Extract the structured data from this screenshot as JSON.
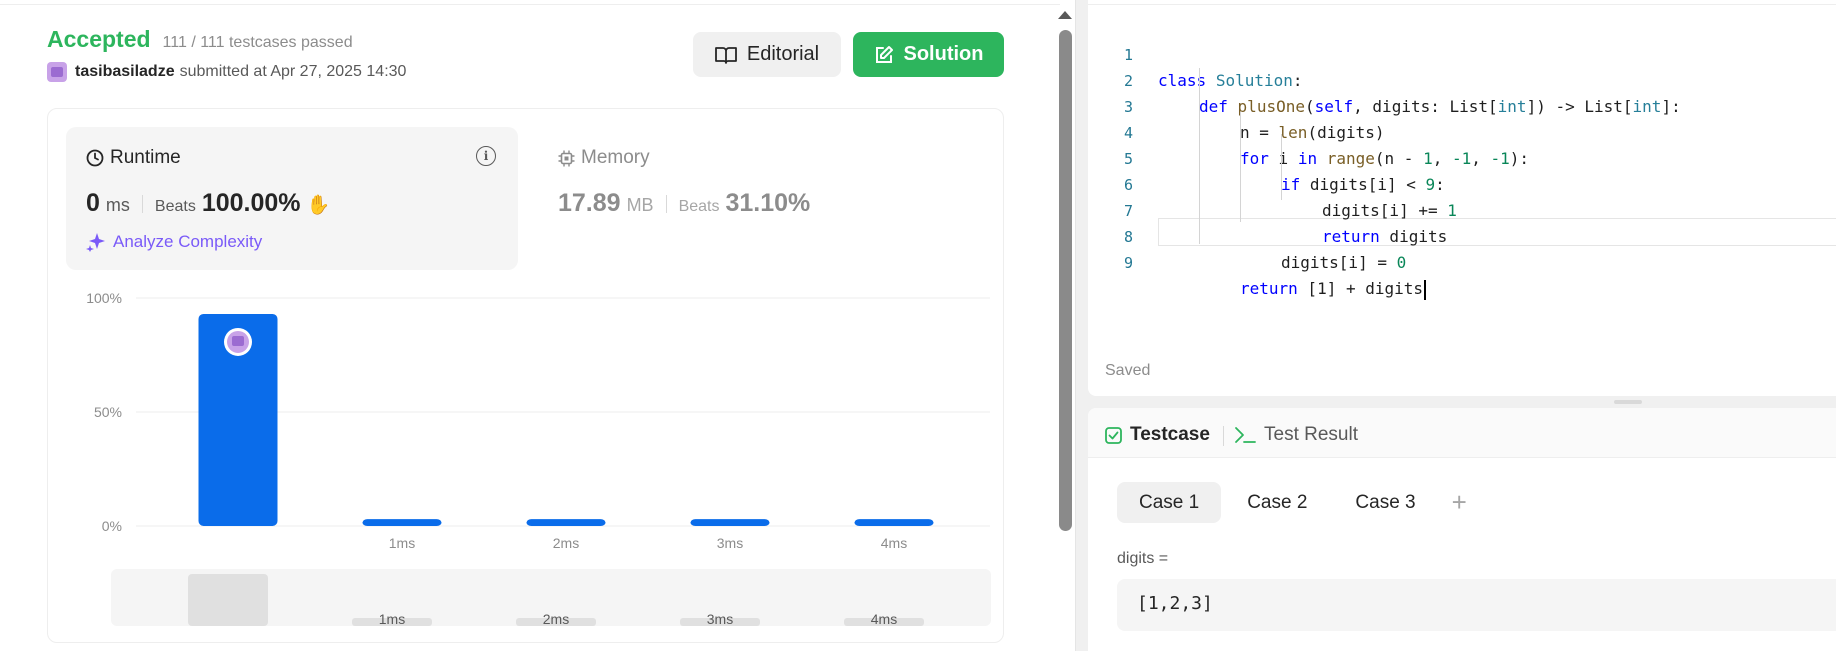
{
  "submission": {
    "status": "Accepted",
    "testcases": "111 / 111 testcases passed",
    "username": "tasibasiladze",
    "submitted_text": "submitted at Apr 27, 2025 14:30"
  },
  "buttons": {
    "editorial": "Editorial",
    "solution": "Solution"
  },
  "runtime": {
    "title": "Runtime",
    "value": "0",
    "unit": "ms",
    "beats_label": "Beats",
    "beats": "100.00%",
    "analyze": "Analyze Complexity"
  },
  "memory": {
    "title": "Memory",
    "value": "17.89",
    "unit": "MB",
    "beats_label": "Beats",
    "beats": "31.10%"
  },
  "chart_data": {
    "type": "bar",
    "categories": [
      "",
      "1ms",
      "2ms",
      "3ms",
      "4ms"
    ],
    "values": [
      93,
      3,
      3,
      3,
      3
    ],
    "yticks": [
      "0%",
      "50%",
      "100%"
    ],
    "ylim": [
      0,
      100
    ],
    "highlight_index": 0,
    "overview_categories": [
      "",
      "1ms",
      "2ms",
      "3ms",
      "4ms"
    ],
    "colors": {
      "bar": "#0a6cea",
      "grid": "#eeeeee",
      "overview_bg": "#f5f5f5",
      "overview_bar": "#e0e0e0"
    }
  },
  "editor": {
    "lines": [
      {
        "n": "1"
      },
      {
        "n": "2"
      },
      {
        "n": "3"
      },
      {
        "n": "4"
      },
      {
        "n": "5"
      },
      {
        "n": "6"
      },
      {
        "n": "7"
      },
      {
        "n": "8"
      },
      {
        "n": "9"
      }
    ],
    "code": {
      "l1_kw": "class",
      "l1_cls": "Solution",
      "l1_rest": ":",
      "l2_kw": "def",
      "l2_fn": "plusOne",
      "l2_a": "(",
      "l2_self": "self",
      "l2_b": ", digits: List[",
      "l2_int1": "int",
      "l2_c": "]) -> List[",
      "l2_int2": "int",
      "l2_d": "]:",
      "l3_a": "n = ",
      "l3_fn": "len",
      "l3_b": "(digits)",
      "l4_for": "for",
      "l4_a": " i ",
      "l4_in": "in",
      "l4_sp": " ",
      "l4_fn": "range",
      "l4_b": "(n - ",
      "l4_n1": "1",
      "l4_c": ", ",
      "l4_n2": "-1",
      "l4_d": ", ",
      "l4_n3": "-1",
      "l4_e": "):",
      "l5_if": "if",
      "l5_a": " digits[i] < ",
      "l5_n": "9",
      "l5_b": ":",
      "l6_a": "digits[i] += ",
      "l6_n": "1",
      "l7_ret": "return",
      "l7_a": " digits",
      "l8_a": "digits[i] = ",
      "l8_n": "0",
      "l9_ret": "return",
      "l9_a": " [1] + digits"
    },
    "saved": "Saved"
  },
  "testpanel": {
    "tab_testcase": "Testcase",
    "tab_result": "Test Result",
    "cases": [
      "Case 1",
      "Case 2",
      "Case 3"
    ],
    "active_case": 0,
    "add": "+",
    "param_label": "digits =",
    "param_value": "[1,2,3]"
  }
}
